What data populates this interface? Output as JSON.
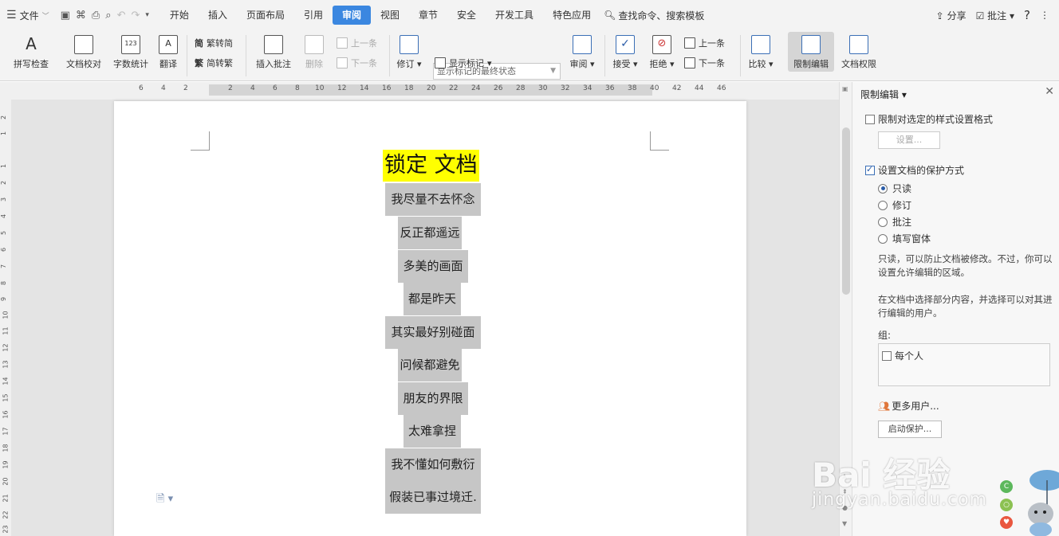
{
  "menubar": {
    "file_label": "文件",
    "tabs": [
      "开始",
      "插入",
      "页面布局",
      "引用",
      "审阅",
      "视图",
      "章节",
      "安全",
      "开发工具",
      "特色应用"
    ],
    "active_tab": "审阅",
    "search_label": "查找命令、搜索模板",
    "share_label": "分享",
    "comment_label": "批注",
    "help": "?"
  },
  "ribbon": {
    "spell_check": "拼写检查",
    "doc_proofread": "文档校对",
    "word_count": "字数统计",
    "translate": "翻译",
    "trad_to_simp": "繁转简",
    "simp_to_trad": "简转繁",
    "insert_comment": "插入批注",
    "delete": "删除",
    "prev_comment": "上一条",
    "next_comment": "下一条",
    "revise": "修订",
    "markup_select": "显示标记的最终状态",
    "show_markup": "显示标记",
    "review": "审阅",
    "accept": "接受",
    "reject": "拒绝",
    "prev_change": "上一条",
    "next_change": "下一条",
    "compare": "比较",
    "restrict_edit": "限制编辑",
    "doc_permission": "文档权限"
  },
  "ruler": {
    "h_ticks": [
      "6",
      "4",
      "2",
      "2",
      "4",
      "6",
      "8",
      "10",
      "12",
      "14",
      "16",
      "18",
      "20",
      "22",
      "24",
      "26",
      "28",
      "30",
      "32",
      "34",
      "36",
      "38",
      "40",
      "42",
      "44",
      "46"
    ],
    "v_ticks": [
      "2",
      "1",
      "1",
      "2",
      "3",
      "4",
      "5",
      "6",
      "7",
      "8",
      "9",
      "10",
      "11",
      "12",
      "13",
      "14",
      "15",
      "16",
      "17",
      "18",
      "19",
      "20",
      "21",
      "22",
      "23"
    ]
  },
  "document": {
    "title": "锁定 文档",
    "lines": [
      "我尽量不去怀念",
      "反正都遥远",
      "多美的画面",
      "都是昨天",
      "其实最好别碰面",
      "问候都避免",
      "朋友的界限",
      "太难拿捏",
      "我不懂如何敷衍",
      "假装已事过境迁."
    ]
  },
  "panel": {
    "title": "限制编辑",
    "restrict_format_label": "限制对选定的样式设置格式",
    "settings_button": "设置...",
    "protect_label": "设置文档的保护方式",
    "options": [
      "只读",
      "修订",
      "批注",
      "填写窗体"
    ],
    "selected_option": "只读",
    "desc1": "只读，可以防止文档被修改。不过，你可以设置允许编辑的区域。",
    "desc2": "在文档中选择部分内容，并选择可以对其进行编辑的用户。",
    "group_label": "组:",
    "everyone_label": "每个人",
    "more_users": "更多用户...",
    "start_protect": "启动保护..."
  },
  "watermark": {
    "brand": "Bai 经验",
    "url": "jingyan.baidu.com"
  }
}
